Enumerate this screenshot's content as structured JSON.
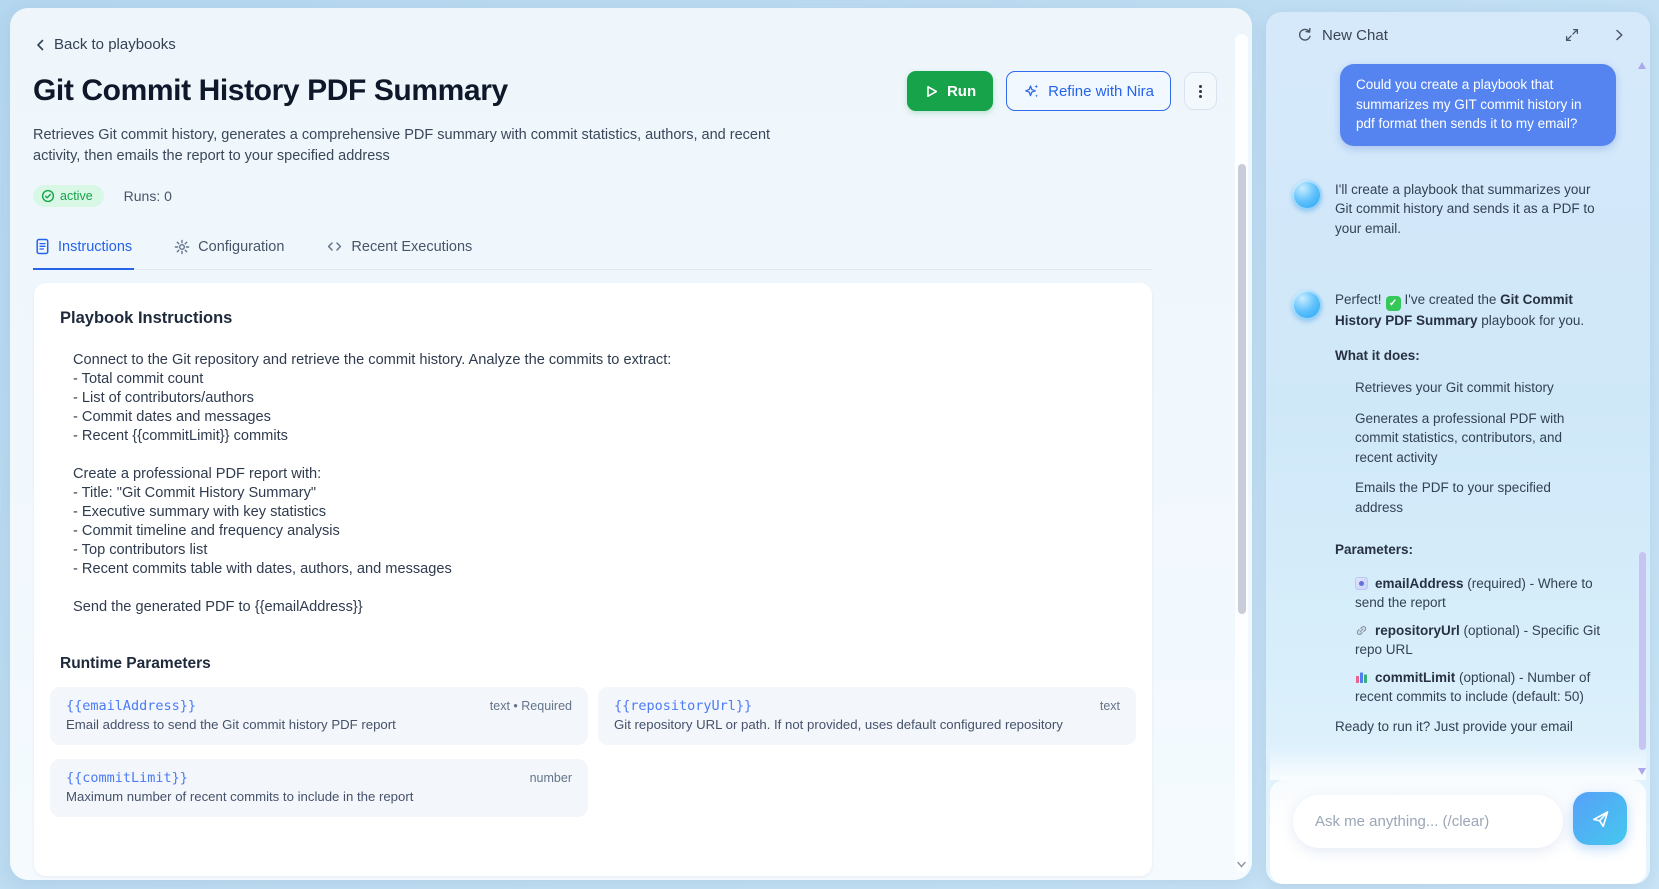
{
  "colors": {
    "accent_blue": "#2563eb",
    "run_green": "#16a34a",
    "param_name_blue": "#4b7bf5",
    "status_badge_bg": "#d9f7e5",
    "status_badge_text": "#16a34a",
    "user_bubble_blue": "#5584f1",
    "send_gradient_start": "#57a0f8",
    "send_gradient_end": "#45c8ee"
  },
  "main": {
    "back_link": "Back to playbooks",
    "title": "Git Commit History PDF Summary",
    "description": "Retrieves Git commit history, generates a comprehensive PDF summary with commit statistics, authors, and recent activity, then emails the report to your specified address",
    "status_badge": "active",
    "runs_label": "Runs: 0",
    "run_label": "Run",
    "refine_label": "Refine with Nira",
    "tabs": [
      {
        "label": "Instructions",
        "icon": "document-icon"
      },
      {
        "label": "Configuration",
        "icon": "gear-icon"
      },
      {
        "label": "Recent Executions",
        "icon": "code-icon"
      }
    ],
    "card": {
      "heading": "Playbook Instructions",
      "instructions": "Connect to the Git repository and retrieve the commit history. Analyze the commits to extract:\n- Total commit count\n- List of contributors/authors\n- Commit dates and messages\n- Recent {{commitLimit}} commits\n\nCreate a professional PDF report with:\n- Title: \"Git Commit History Summary\"\n- Executive summary with key statistics\n- Commit timeline and frequency analysis\n- Top contributors list\n- Recent commits table with dates, authors, and messages\n\nSend the generated PDF to {{emailAddress}}",
      "runtime_heading": "Runtime Parameters",
      "parameters": [
        {
          "name": "{{emailAddress}}",
          "type": "text • Required",
          "description": "Email address to send the Git commit history PDF report"
        },
        {
          "name": "{{repositoryUrl}}",
          "type": "text",
          "description": "Git repository URL or path. If not provided, uses default configured repository"
        },
        {
          "name": "{{commitLimit}}",
          "type": "number",
          "description": "Maximum number of recent commits to include in the report"
        }
      ]
    }
  },
  "chat": {
    "title": "New Chat",
    "user_message": "Could you create a playbook that summarizes my GIT commit history in pdf format then sends it to my email?",
    "assistant_intro": "I'll create a playbook that summarizes your Git commit history and sends it as a PDF to your email.",
    "confirm": {
      "prefix": "Perfect!",
      "mid": "I've created the ",
      "bold": "Git Commit History PDF Summary",
      "suffix": " playbook for you."
    },
    "what_label": "What it does:",
    "what_bullets": [
      "Retrieves your Git commit history",
      "Generates a professional PDF with commit statistics, contributors, and recent activity",
      "Emails the PDF to your specified address"
    ],
    "params_label": "Parameters:",
    "param_bullets": [
      {
        "icon": "email-icon",
        "name": "emailAddress",
        "rest": " (required) - Where to send the report"
      },
      {
        "icon": "link-icon",
        "name": "repositoryUrl",
        "rest": " (optional) - Specific Git repo URL"
      },
      {
        "icon": "bar-chart-icon",
        "name": "commitLimit",
        "rest": " (optional) - Number of recent commits to include (default: 50)"
      }
    ],
    "teaser": "Ready to run it? Just provide your email",
    "input_placeholder": "Ask me anything... (/clear)"
  }
}
